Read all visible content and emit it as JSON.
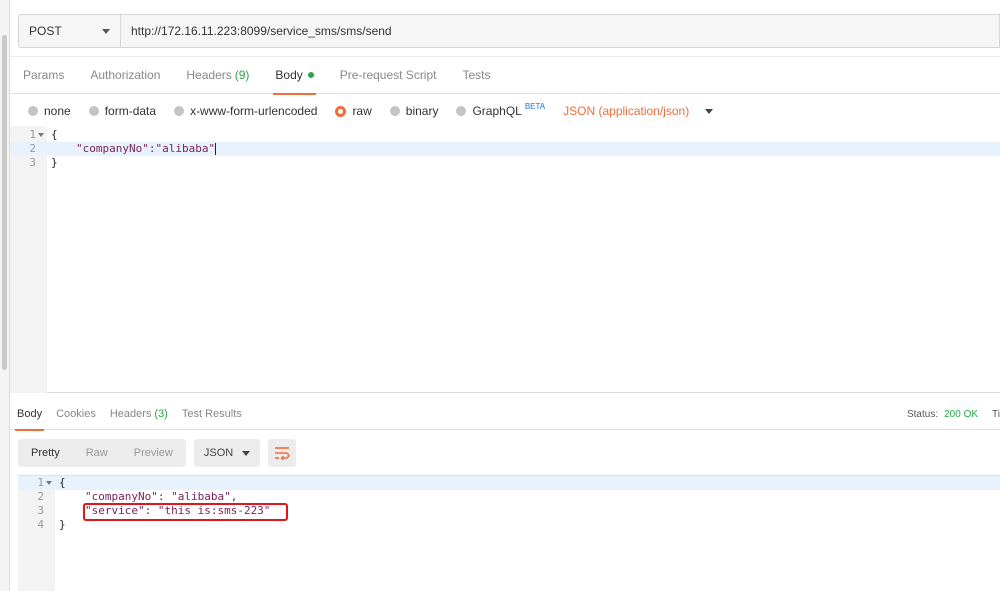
{
  "request": {
    "method": "POST",
    "url": "http://172.16.11.223:8099/service_sms/sms/send"
  },
  "request_tabs": [
    {
      "label": "Params"
    },
    {
      "label": "Authorization"
    },
    {
      "label": "Headers",
      "count": "(9)"
    },
    {
      "label": "Body"
    },
    {
      "label": "Pre-request Script"
    },
    {
      "label": "Tests"
    }
  ],
  "body_types": [
    {
      "label": "none"
    },
    {
      "label": "form-data"
    },
    {
      "label": "x-www-form-urlencoded"
    },
    {
      "label": "raw",
      "selected": true
    },
    {
      "label": "binary"
    },
    {
      "label": "GraphQL",
      "badge": "BETA"
    }
  ],
  "content_type": "JSON (application/json)",
  "request_body": {
    "line_numbers": [
      "1",
      "2",
      "3"
    ],
    "lines": [
      "{",
      "\"companyNo\":\"alibaba\"",
      "}"
    ]
  },
  "response_tabs": [
    {
      "label": "Body"
    },
    {
      "label": "Cookies"
    },
    {
      "label": "Headers",
      "count": "(3)"
    },
    {
      "label": "Test Results"
    }
  ],
  "status": {
    "label": "Status:",
    "value": "200 OK",
    "time_label": "Ti"
  },
  "view_modes": [
    "Pretty",
    "Raw",
    "Preview"
  ],
  "format": "JSON",
  "response_body": {
    "line_numbers": [
      "1",
      "2",
      "3",
      "4"
    ],
    "lines": [
      "{",
      "\"companyNo\": \"alibaba\",",
      "\"service\": \"this is:sms-223\"",
      "}"
    ]
  },
  "colors": {
    "accent": "#f26b3a",
    "success": "#28a745",
    "highlight_box": "#e0161b"
  }
}
